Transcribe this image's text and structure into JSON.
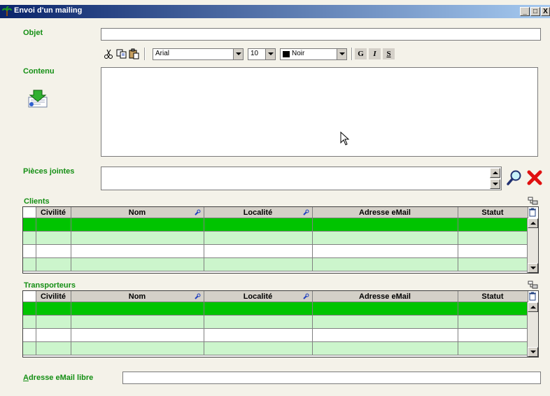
{
  "window": {
    "title": "Envoi d'un mailing",
    "minimize": "_",
    "maximize": "□",
    "close": "X"
  },
  "form": {
    "objet_label": "Objet",
    "objet_value": "",
    "contenu_label": "Contenu",
    "contenu_value": "",
    "pieces_label": "Pièces jointes",
    "adresse_libre_label": "Adresse eMail libre",
    "adresse_libre_underline": "A",
    "adresse_libre_rest": "dresse eMail libre",
    "adresse_libre_value": ""
  },
  "toolbar": {
    "font": "Arial",
    "size": "10",
    "color_name": "Noir",
    "color_swatch": "#000000",
    "bold": "G",
    "italic": "I",
    "underline": "S"
  },
  "clients": {
    "title": "Clients",
    "columns": [
      "Civilité",
      "Nom",
      "Localité",
      "Adresse eMail",
      "Statut"
    ]
  },
  "transporteurs": {
    "title": "Transporteurs",
    "columns": [
      "Civilité",
      "Nom",
      "Localité",
      "Adresse eMail",
      "Statut"
    ]
  },
  "colors": {
    "label_green": "#148f14",
    "selected_row": "#00c400",
    "alt_row": "#ccf5cc",
    "delete_red": "#e01010"
  }
}
